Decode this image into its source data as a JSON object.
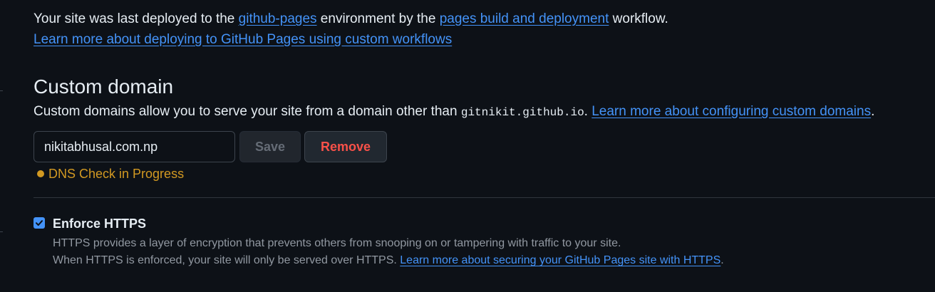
{
  "deployment": {
    "prefix": "Your site was last deployed to the ",
    "environment_link": "github-pages",
    "middle": " environment by the ",
    "workflow_link": "pages build and deployment",
    "suffix": " workflow.",
    "learn_more_link": "Learn more about deploying to GitHub Pages using custom workflows"
  },
  "custom_domain": {
    "title": "Custom domain",
    "description": "Custom domains allow you to serve your site from a domain other than ",
    "default_domain": "gitnikit.github.io",
    "description_end": ". ",
    "learn_more_link": "Learn more about configuring custom domains",
    "trailing": ".",
    "input_value": "nikitabhusal.com.np",
    "save_label": "Save",
    "remove_label": "Remove",
    "status_text": "DNS Check in Progress"
  },
  "https": {
    "label": "Enforce HTTPS",
    "checked": true,
    "desc_line1": "HTTPS provides a layer of encryption that prevents others from snooping on or tampering with traffic to your site.",
    "desc_line2": "When HTTPS is enforced, your site will only be served over HTTPS. ",
    "learn_more_link": "Learn more about securing your GitHub Pages site with HTTPS",
    "trailing": "."
  },
  "icons": {
    "status_dot": "status-dot-icon",
    "checkbox_check": "check-icon"
  },
  "colors": {
    "background": "#0d1117",
    "link": "#4493f8",
    "warning": "#d29922",
    "danger": "#f85149",
    "muted": "#9198a1"
  }
}
